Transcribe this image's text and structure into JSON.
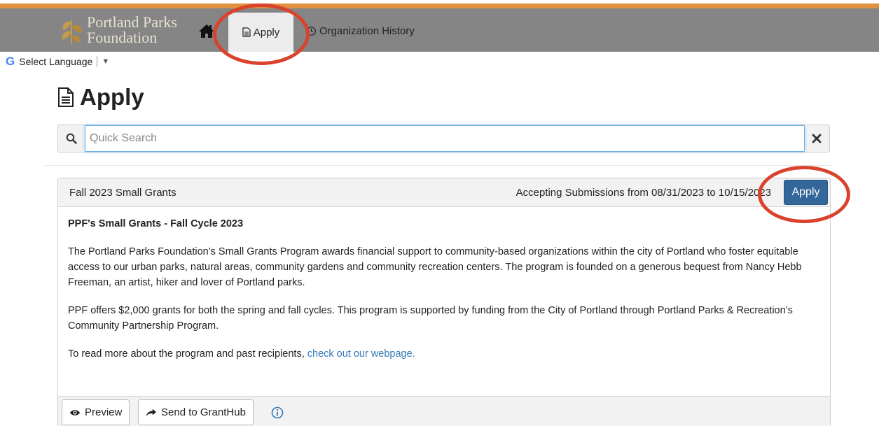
{
  "nav": {
    "logo_line1": "Portland Parks",
    "logo_line2": "Foundation",
    "apply_label": "Apply",
    "history_label": "Organization History"
  },
  "language": {
    "g_letter": "G",
    "label": "Select Language",
    "arrow": "▼"
  },
  "page": {
    "title": "Apply"
  },
  "search": {
    "placeholder": "Quick Search",
    "value": ""
  },
  "opportunity": {
    "name": "Fall 2023 Small Grants",
    "dates": "Accepting Submissions from 08/31/2023 to 10/15/2023",
    "apply_label": "Apply",
    "heading": "PPF's Small Grants - Fall Cycle 2023",
    "paragraph1": "The Portland Parks Foundation’s Small Grants Program awards financial support to community-based organizations within the city of Portland who foster equitable access to our urban parks, natural areas, community gardens and community recreation centers.  The program is founded on a generous bequest from Nancy Hebb Freeman, an artist, hiker and lover of Portland parks.",
    "paragraph2": "PPF offers $2,000 grants for both the spring and fall cycles. This program is supported by funding from the City of Portland through Portland Parks & Recreation’s Community Partnership Program.",
    "paragraph3_prefix": "To read more about the program and past recipients, ",
    "paragraph3_link": "check out our webpage.",
    "preview_label": "Preview",
    "send_label": "Send to GrantHub"
  },
  "colors": {
    "accent": "#e0913f",
    "navbar": "#858585",
    "primary": "#336699",
    "link": "#337ab7",
    "annotation": "#d9432d"
  }
}
